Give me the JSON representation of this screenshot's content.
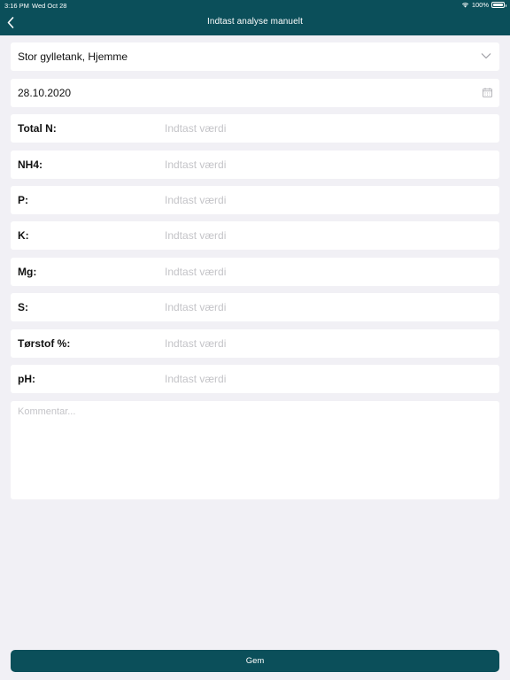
{
  "status_bar": {
    "time": "3:16 PM",
    "date": "Wed Oct 28",
    "battery": "100%",
    "wifi_icon": "wifi-icon",
    "battery_icon": "battery-icon"
  },
  "header": {
    "title": "Indtast analyse manuelt",
    "back_icon": "chevron-left-icon",
    "background": "#0b4f5a"
  },
  "storage_select": {
    "value": "Stor gylletank, Hjemme",
    "icon": "chevron-down-icon"
  },
  "date_field": {
    "value": "28.10.2020",
    "icon": "calendar-icon"
  },
  "fields": [
    {
      "label": "Total N:",
      "placeholder": "Indtast værdi"
    },
    {
      "label": "NH4:",
      "placeholder": "Indtast værdi"
    },
    {
      "label": "P:",
      "placeholder": "Indtast værdi"
    },
    {
      "label": "K:",
      "placeholder": "Indtast værdi"
    },
    {
      "label": "Mg:",
      "placeholder": "Indtast værdi"
    },
    {
      "label": "S:",
      "placeholder": "Indtast værdi"
    },
    {
      "label": "Tørstof %:",
      "placeholder": "Indtast værdi"
    },
    {
      "label": "pH:",
      "placeholder": "Indtast værdi"
    }
  ],
  "comment": {
    "placeholder": "Kommentar..."
  },
  "save_button": {
    "label": "Gem",
    "color": "#0b4f5a"
  }
}
